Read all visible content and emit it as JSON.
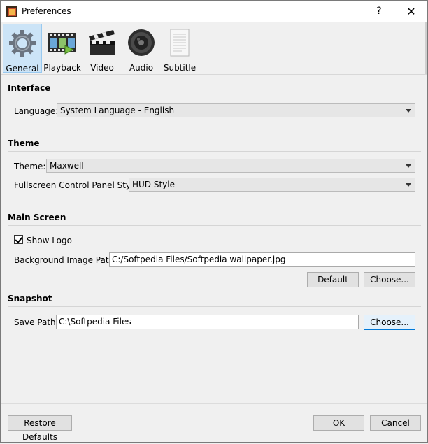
{
  "window": {
    "title": "Preferences",
    "help_glyph": "?",
    "close_glyph": "✕"
  },
  "toolbar": {
    "items": [
      {
        "label": "General",
        "icon": "gear-icon",
        "active": true
      },
      {
        "label": "Playback",
        "icon": "film-strip-icon"
      },
      {
        "label": "Video",
        "icon": "clapperboard-icon"
      },
      {
        "label": "Audio",
        "icon": "speaker-icon"
      },
      {
        "label": "Subtitle",
        "icon": "document-icon"
      }
    ]
  },
  "interface": {
    "title": "Interface",
    "language_label": "Language:",
    "language_value": "System Language - English"
  },
  "theme": {
    "title": "Theme",
    "theme_label": "Theme:",
    "theme_value": "Maxwell",
    "fullscreen_label": "Fullscreen Control Panel Style:",
    "fullscreen_value": "HUD Style"
  },
  "main_screen": {
    "title": "Main Screen",
    "show_logo_label": "Show Logo",
    "show_logo_checked": true,
    "bg_path_label": "Background Image Path:",
    "bg_path_value": "C:/Softpedia Files/Softpedia wallpaper.jpg",
    "default_label": "Default",
    "choose_label": "Choose..."
  },
  "snapshot": {
    "title": "Snapshot",
    "save_path_label": "Save Path:",
    "save_path_value": "C:\\Softpedia Files",
    "choose_label": "Choose..."
  },
  "footer": {
    "restore_label": "Restore Defaults",
    "ok_label": "OK",
    "cancel_label": "Cancel"
  }
}
